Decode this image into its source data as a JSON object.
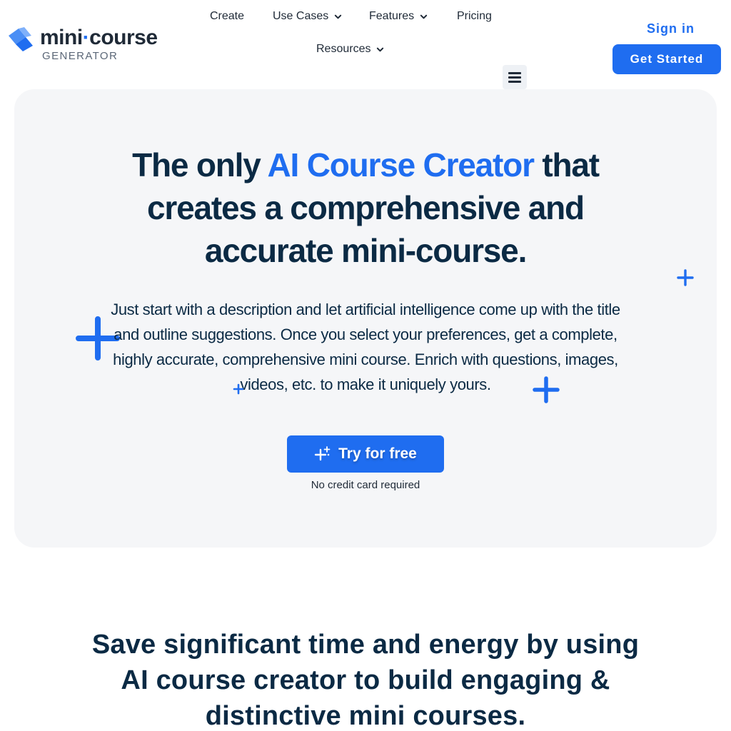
{
  "brand": {
    "name_part1": "mini",
    "name_dot": "·",
    "name_part2": "course",
    "sub": "GENERATOR"
  },
  "nav": {
    "create": "Create",
    "use_cases": "Use Cases",
    "features": "Features",
    "pricing": "Pricing",
    "resources": "Resources"
  },
  "header": {
    "sign_in": "Sign in",
    "get_started": "Get Started"
  },
  "hero": {
    "title_before": "The only ",
    "title_accent": "AI Course Creator",
    "title_after": " that creates a comprehensive and accurate mini-course.",
    "description": "Just start with a description and let artificial intelligence come up with the title and outline suggestions. Once you select your preferences, get a complete, highly accurate, comprehensive mini course. Enrich with questions, images, videos, etc. to make it uniquely yours.",
    "cta_label": "Try for free",
    "cta_note": "No credit card required"
  },
  "section": {
    "title": "Save significant time and energy by using AI course creator to build engaging & distinctive mini courses."
  },
  "colors": {
    "accent": "#1f6df0",
    "heading": "#0b2a44",
    "hero_bg": "#f5f6f8"
  },
  "icons": {
    "logo": "logo-mark-icon",
    "chevron": "chevron-down-icon",
    "menu": "hamburger-menu-icon",
    "sparkle": "sparkle-icon",
    "plus": "plus-icon"
  }
}
